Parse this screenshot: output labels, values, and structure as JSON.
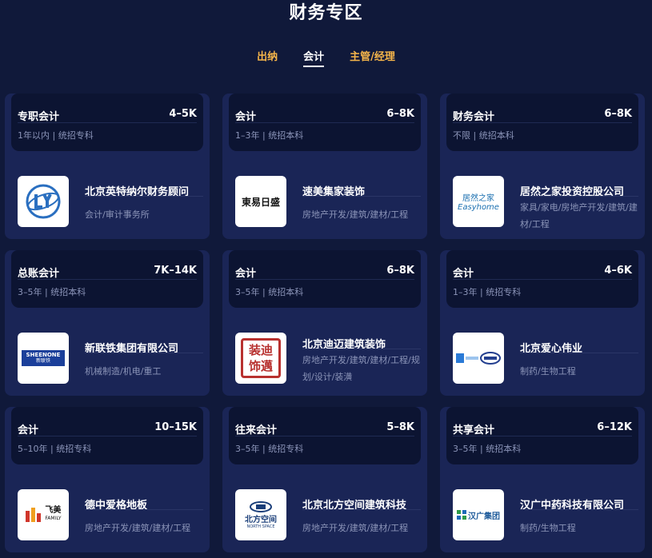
{
  "header": {
    "title": "财务专区"
  },
  "tabs": [
    {
      "label": "出纳",
      "active": false
    },
    {
      "label": "会计",
      "active": true
    },
    {
      "label": "主管/经理",
      "active": false
    }
  ],
  "colors": {
    "background": "#10193a",
    "card": "#1a2556",
    "card_top": "#0c1432",
    "tab_inactive": "#f5b54a",
    "muted_text": "#8b94b8"
  },
  "jobs": [
    {
      "title": "专职会计",
      "salary": "4–5K",
      "meta": "1年以内 | 统招专科",
      "company": "北京英特纳尔财务顾问",
      "tags": "会计/审计事务所",
      "logo": "lyh-logo-icon"
    },
    {
      "title": "会计",
      "salary": "6–8K",
      "meta": "1–3年 | 统招本科",
      "company": "速美集家装饰",
      "tags": "房地产开发/建筑/建材/工程",
      "logo": "dongyirisheng-logo-icon",
      "logo_text": "東易日盛"
    },
    {
      "title": "财务会计",
      "salary": "6–8K",
      "meta": "不限 | 统招本科",
      "company": "居然之家投资控股公司",
      "tags": "家具/家电/房地产开发/建筑/建材/工程",
      "logo": "easyhome-logo-icon",
      "logo_text": "居然之家",
      "logo_sub": "Easyhome"
    },
    {
      "title": "总账会计",
      "salary": "7K–14K",
      "meta": "3–5年 | 统招本科",
      "company": "新联铁集团有限公司",
      "tags": "机械制造/机电/重工",
      "logo": "sheenone-logo-icon",
      "logo_text": "SHEENONE",
      "logo_sub": "新联铁"
    },
    {
      "title": "会计",
      "salary": "6–8K",
      "meta": "3–5年 | 统招本科",
      "company": "北京迪迈建筑装饰",
      "tags": "房地产开发/建筑/建材/工程/规划/设计/装潢",
      "logo": "seal-logo-icon",
      "logo_text": "装迪饰邁"
    },
    {
      "title": "会计",
      "salary": "4–6K",
      "meta": "1–3年 | 统招专科",
      "company": "北京爱心伟业",
      "tags": "制药/生物工程",
      "logo": "aixin-logo-icon"
    },
    {
      "title": "会计",
      "salary": "10–15K",
      "meta": "5–10年 | 统招专科",
      "company": "德中爱格地板",
      "tags": "房地产开发/建筑/建材/工程",
      "logo": "feimei-logo-icon",
      "logo_text": "飞美",
      "logo_sub": "FAMILY"
    },
    {
      "title": "往来会计",
      "salary": "5–8K",
      "meta": "3–5年 | 统招专科",
      "company": "北京北方空间建筑科技",
      "tags": "房地产开发/建筑/建材/工程",
      "logo": "northspace-logo-icon",
      "logo_text": "北方空间",
      "logo_sub": "NORTH SPACE"
    },
    {
      "title": "共享会计",
      "salary": "6–12K",
      "meta": "3–5年 | 统招本科",
      "company": "汉广中药科技有限公司",
      "tags": "制药/生物工程",
      "logo": "hanguang-logo-icon",
      "logo_text": "汉广集团"
    }
  ]
}
